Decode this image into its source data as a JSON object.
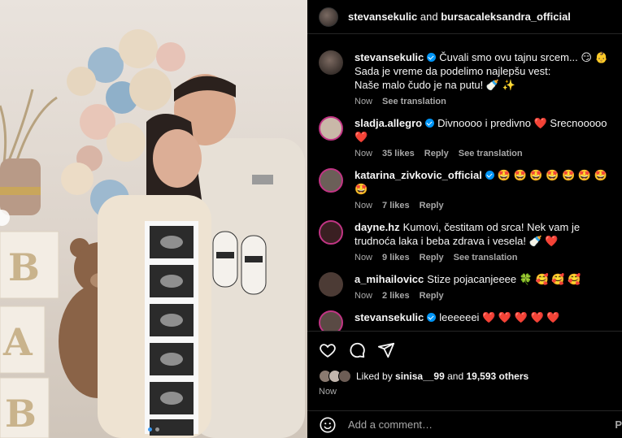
{
  "post": {
    "header": {
      "user1": "stevansekulic",
      "and": "and",
      "user2": "bursacaleksandra_official"
    },
    "caption": {
      "user": "stevansekulic",
      "line1": "Čuvali smo ovu tajnu srcem... 😏 👶",
      "line2": "Sada je vreme da podelimo najlepšu vest:",
      "line3": "Naše malo čudo je na putu! 🍼 ✨",
      "time": "Now",
      "translate": "See translation"
    },
    "comments": [
      {
        "user": "sladja.allegro",
        "verified": true,
        "text": "Divnoooo i predivno ❤️ Srecnooooo ❤️",
        "time": "Now",
        "likes": "35 likes",
        "reply": "Reply",
        "translate": "See translation"
      },
      {
        "user": "katarina_zivkovic_official",
        "verified": true,
        "text": "🤩 🤩 🤩 🤩 🤩 🤩 🤩 🤩",
        "time": "Now",
        "likes": "7 likes",
        "reply": "Reply",
        "translate": ""
      },
      {
        "user": "dayne.hz",
        "verified": false,
        "text": "Kumovi, čestitam od srca! Nek vam je trudnoća laka i beba zdrava i vesela! 🍼 ❤️",
        "time": "Now",
        "likes": "9 likes",
        "reply": "Reply",
        "translate": "See translation"
      },
      {
        "user": "a_mihailovicc",
        "verified": false,
        "text": "Stize pojacanjeeee 🍀 🥰 🥰 🥰",
        "time": "Now",
        "likes": "2 likes",
        "reply": "Reply",
        "translate": ""
      },
      {
        "user": "stevansekulic",
        "verified": true,
        "text": "leeeeeei ❤️ ❤️ ❤️ ❤️ ❤️",
        "time": "",
        "likes": "",
        "reply": "",
        "translate": ""
      }
    ],
    "likes": {
      "prefix": "Liked by",
      "user": "sinisa__99",
      "and": "and",
      "count": "19,593 others"
    },
    "timestamp": "Now",
    "add_comment_placeholder": "Add a comment…",
    "post_label": "P"
  },
  "icons": [
    "heart-icon",
    "comment-icon",
    "share-icon",
    "emoji-icon"
  ],
  "colors": {
    "verified": "#0095f6",
    "background": "#000000",
    "muted": "#a8a8a8"
  }
}
